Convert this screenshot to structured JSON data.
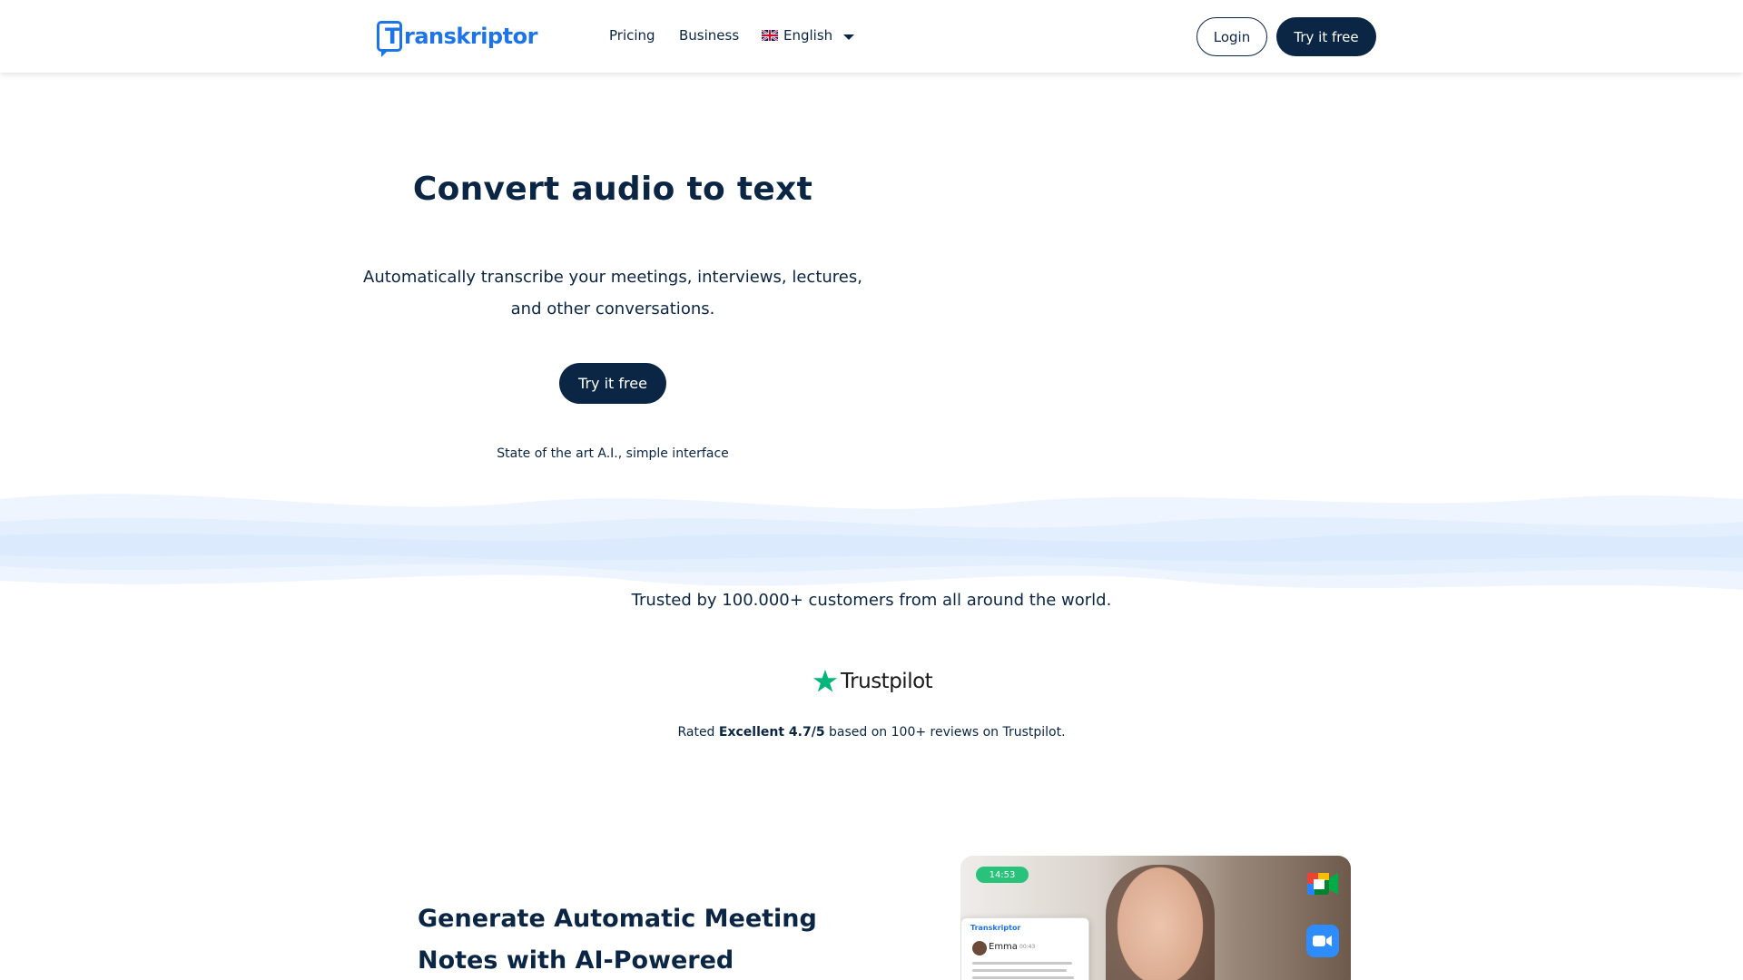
{
  "header": {
    "logo_text": "ranskriptor",
    "logo_letter": "T",
    "nav": {
      "pricing": "Pricing",
      "business": "Business"
    },
    "language": "English",
    "login_label": "Login",
    "try_label": "Try it free"
  },
  "hero": {
    "title": "Convert audio to text",
    "subtitle_line1": "Automatically transcribe your meetings, interviews, lectures,",
    "subtitle_line2": "and other conversations.",
    "cta_label": "Try it free",
    "tagline": "State of the art A.I., simple interface"
  },
  "social_proof": {
    "trusted_text": "Trusted by 100.000+ customers from all around the world.",
    "trustpilot_name": "Trustpilot",
    "rated_prefix": "Rated",
    "rated_bold": "Excellent 4.7/5",
    "rated_suffix": "based on 100+ reviews on Trustpilot."
  },
  "feature": {
    "title_line1": "Generate Automatic Meeting",
    "title_line2": "Notes with AI-Powered",
    "media": {
      "timer": "14:53",
      "card_logo": "Transkriptor",
      "card_name": "Emma",
      "card_time": "00:43"
    }
  },
  "colors": {
    "brand_blue": "#1d74e8",
    "navy": "#0b2545",
    "trustpilot_green": "#00b67a",
    "wave_light": "#e6f1fd"
  },
  "icons": [
    "logo-icon",
    "uk-flag-icon",
    "chevron-down-icon",
    "trustpilot-star-icon",
    "google-meet-icon",
    "zoom-icon"
  ]
}
